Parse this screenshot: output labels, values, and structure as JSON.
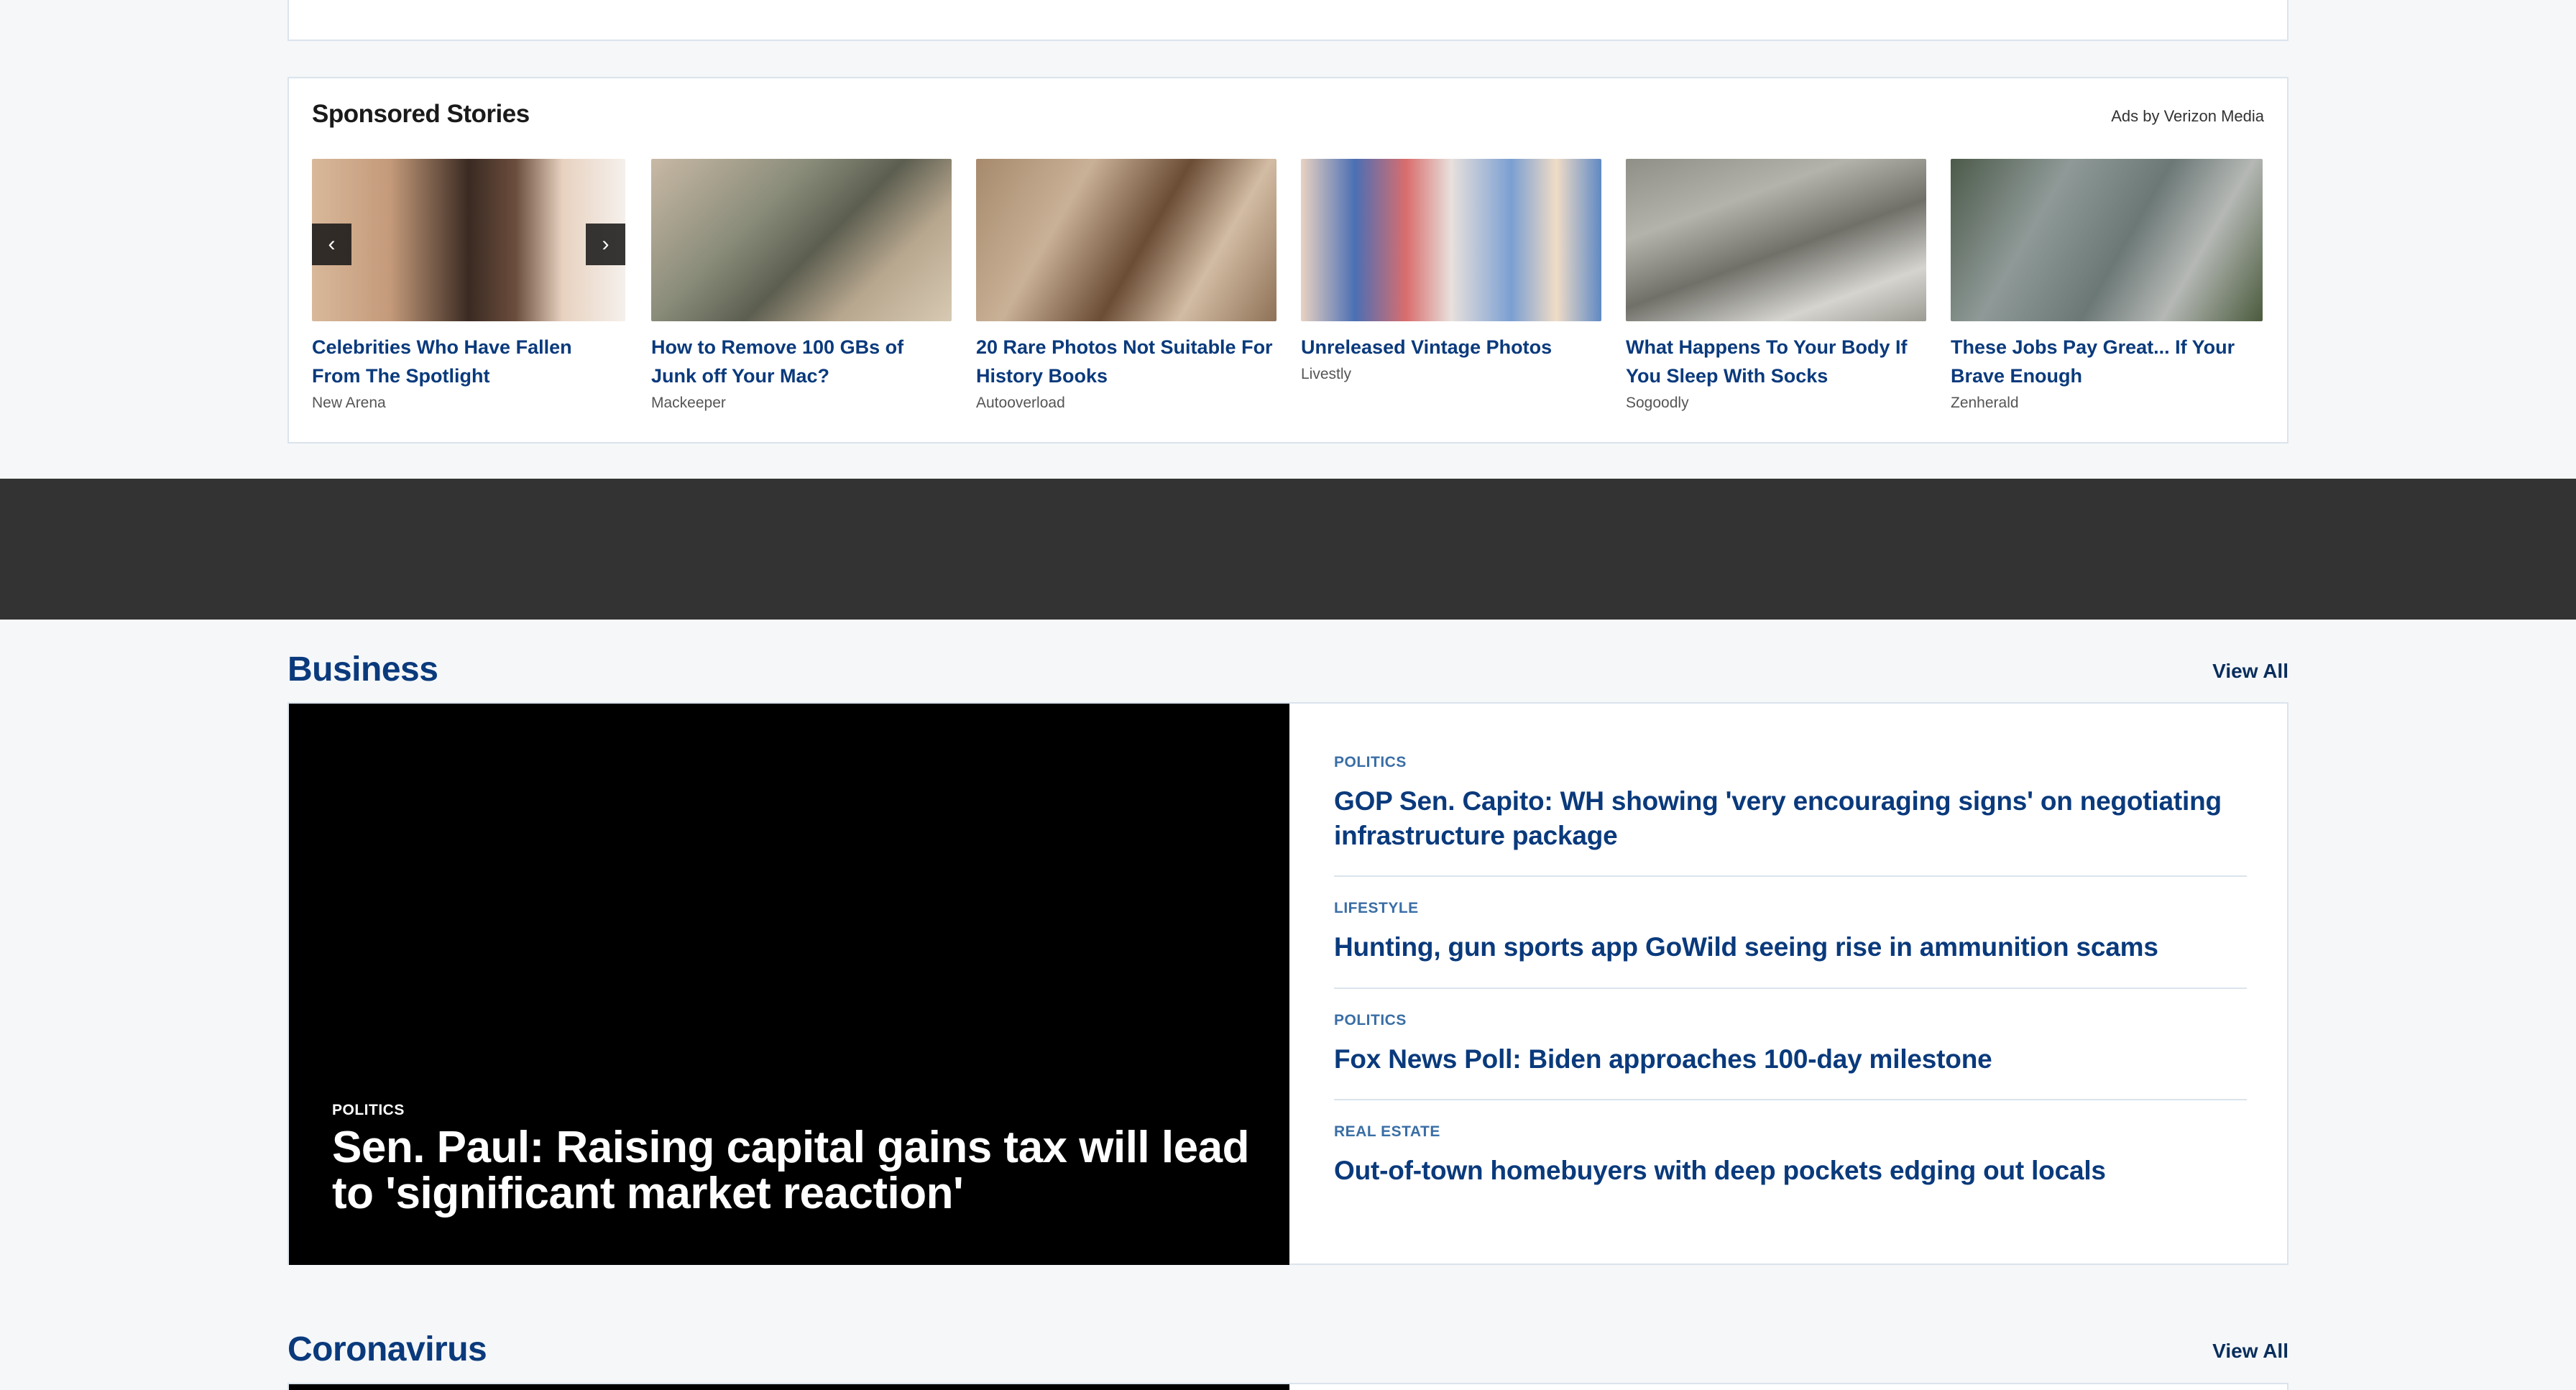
{
  "sponsored": {
    "title": "Sponsored Stories",
    "ads_by": "Ads by Verizon Media",
    "items": [
      {
        "headline": "Celebrities Who Have Fallen From The Spotlight",
        "source": "New Arena"
      },
      {
        "headline": "How to Remove 100 GBs of Junk off Your Mac?",
        "source": "Mackeeper"
      },
      {
        "headline": "20 Rare Photos Not Suitable For History Books",
        "source": "Autooverload"
      },
      {
        "headline": "Unreleased Vintage Photos",
        "source": "Livestly"
      },
      {
        "headline": "What Happens To Your Body If You Sleep With Socks",
        "source": "Sogoodly"
      },
      {
        "headline": "These Jobs Pay Great... If Your Brave Enough",
        "source": "Zenherald"
      }
    ],
    "prev_icon": "chevron-left-icon",
    "next_icon": "chevron-right-icon"
  },
  "business": {
    "title": "Business",
    "view_all": "View All",
    "hero": {
      "category": "POLITICS",
      "headline": "Sen. Paul: Raising capital gains tax will lead to 'significant market reaction'"
    },
    "items": [
      {
        "category": "POLITICS",
        "headline": "GOP Sen. Capito: WH showing 'very encouraging signs' on negotiating infrastructure package"
      },
      {
        "category": "LIFESTYLE",
        "headline": "Hunting, gun sports app GoWild seeing rise in ammunition scams"
      },
      {
        "category": "POLITICS",
        "headline": "Fox News Poll: Biden approaches 100-day milestone"
      },
      {
        "category": "REAL ESTATE",
        "headline": "Out-of-town homebuyers with deep pockets edging out locals"
      }
    ]
  },
  "coronavirus": {
    "title": "Coronavirus",
    "view_all": "View All"
  },
  "colors": {
    "page_bg": "#f5f7f9",
    "brand_navy": "#0a3a7c",
    "category_blue": "#3a6ea5",
    "ad_band": "#333333",
    "border": "#dbe4ec"
  }
}
